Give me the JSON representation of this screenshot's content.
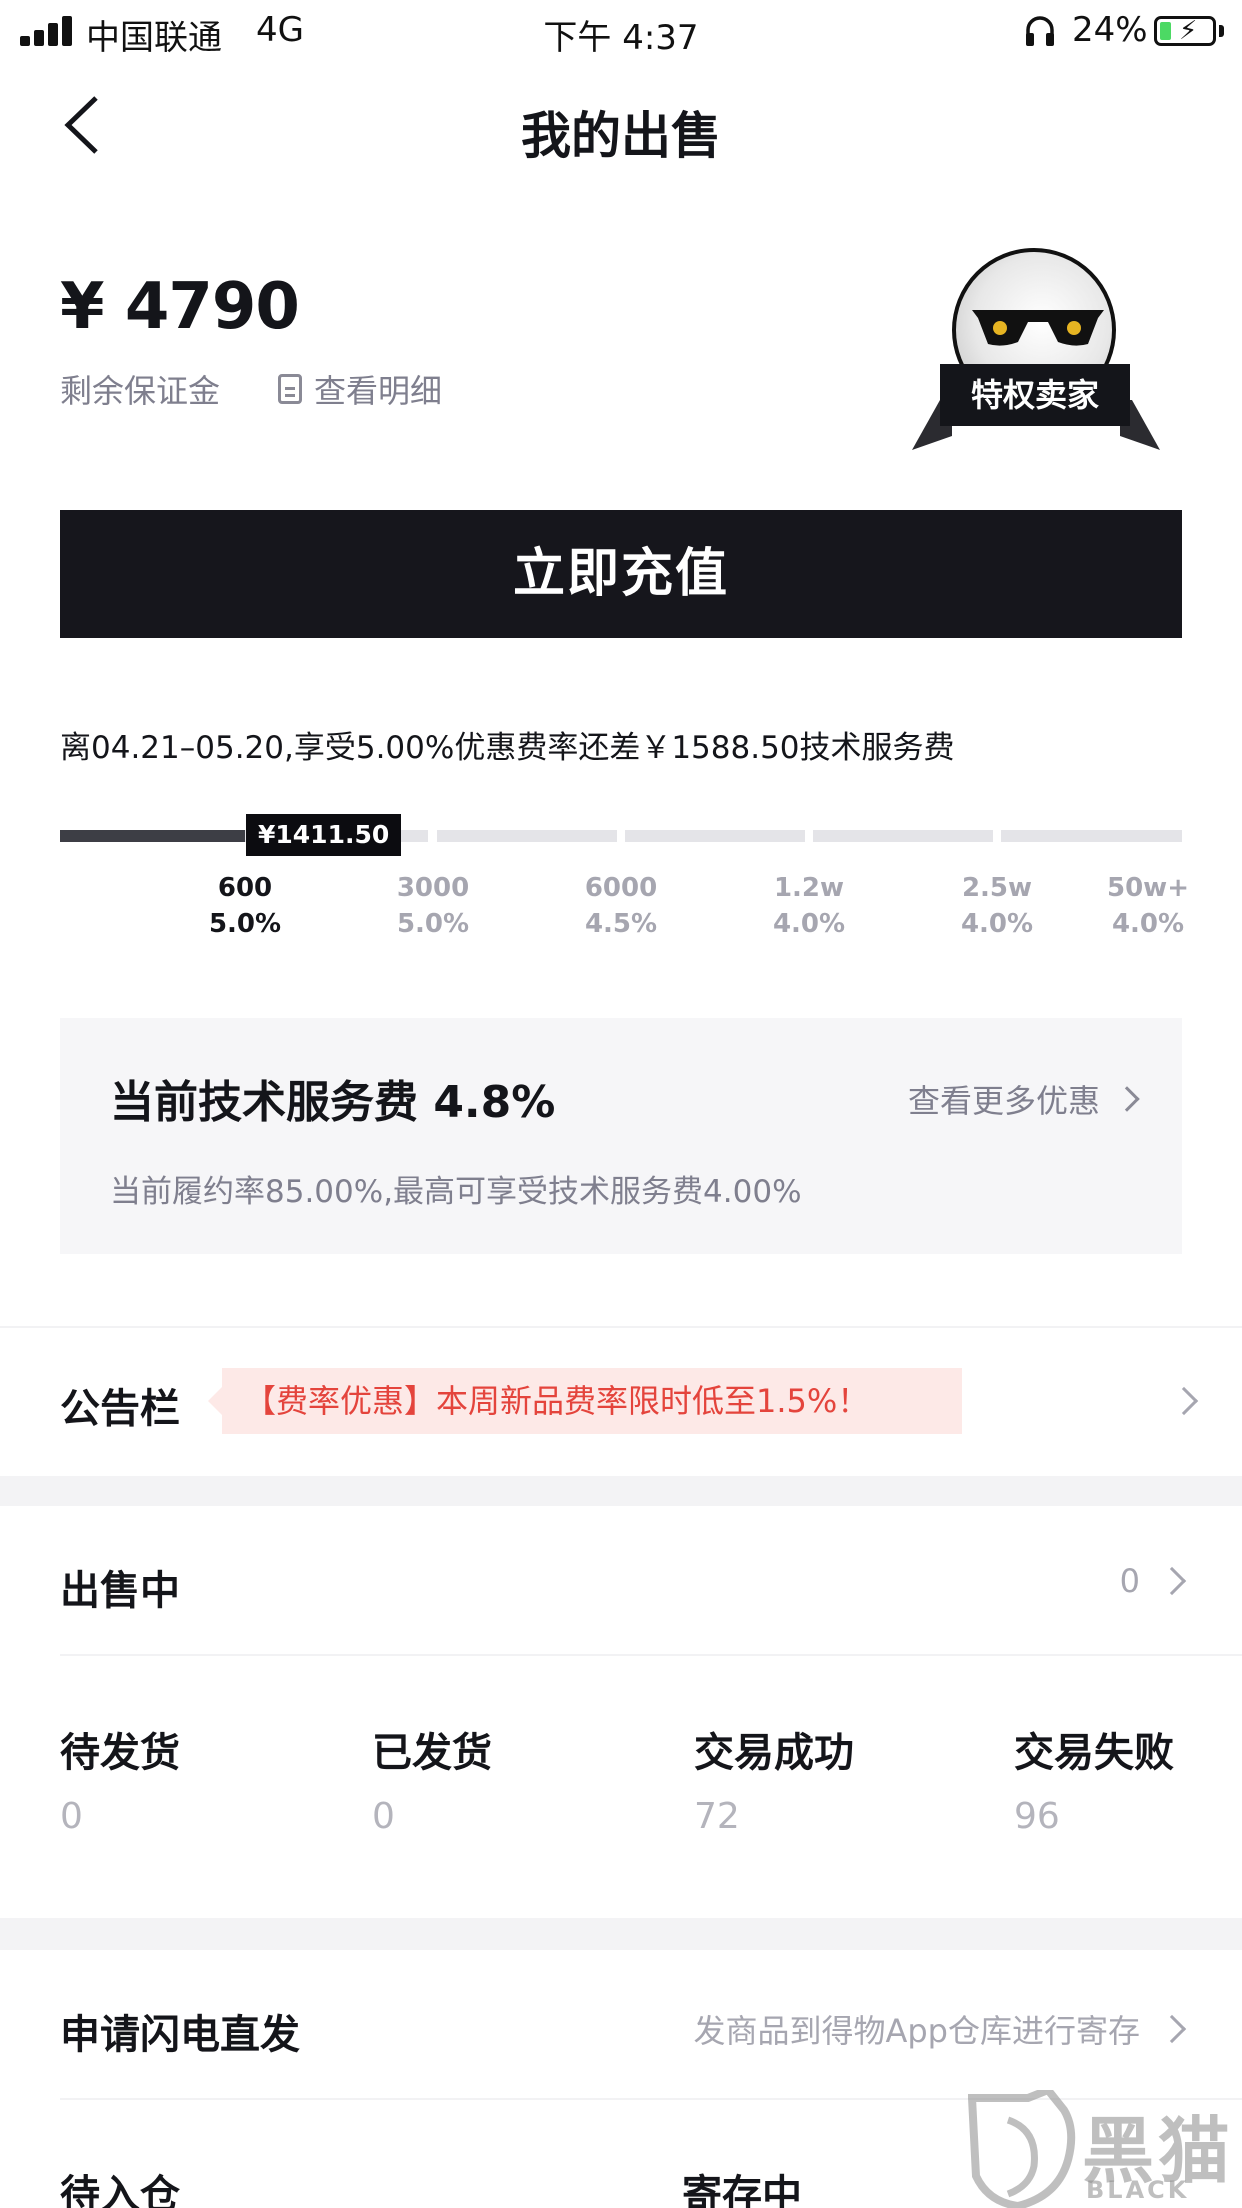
{
  "status_bar": {
    "carrier": "中国联通",
    "network": "4G",
    "time": "下午 4:37",
    "battery": "24%"
  },
  "header": {
    "title": "我的出售"
  },
  "deposit": {
    "amount": "¥ 4790",
    "label": "剩余保证金",
    "detail_link": "查看明细"
  },
  "seller_badge": "特权卖家",
  "recharge_label": "立即充值",
  "fee_notice": "离04.21–05.20,享受5.00%优惠费率还差￥1588.50技术服务费",
  "progress": {
    "current_value": "¥1411.50",
    "fraction": 0.165,
    "tiers": [
      {
        "threshold": "600",
        "rate": "5.0%"
      },
      {
        "threshold": "3000",
        "rate": "5.0%"
      },
      {
        "threshold": "6000",
        "rate": "4.5%"
      },
      {
        "threshold": "1.2w",
        "rate": "4.0%"
      },
      {
        "threshold": "2.5w",
        "rate": "4.0%"
      },
      {
        "threshold": "50w+",
        "rate": "4.0%"
      }
    ]
  },
  "current_fee": {
    "title": "当前技术服务费 4.8%",
    "more_link": "查看更多优惠",
    "subtitle": "当前履约率85.00%,最高可享受技术服务费4.00%"
  },
  "bulletin": {
    "label": "公告栏",
    "notice": "【费率优惠】本周新品费率限时低至1.5%！"
  },
  "on_sale": {
    "label": "出售中",
    "count": "0"
  },
  "order_stats": [
    {
      "label": "待发货",
      "value": "0"
    },
    {
      "label": "已发货",
      "value": "0"
    },
    {
      "label": "交易成功",
      "value": "72"
    },
    {
      "label": "交易失败",
      "value": "96"
    }
  ],
  "lightning": {
    "label": "申请闪电直发",
    "hint": "发商品到得物App仓库进行寄存"
  },
  "storage": {
    "pending_label": "待入仓",
    "stored_label": "寄存中"
  },
  "watermark": {
    "text": "黑猫",
    "sub": "BLACK CAT"
  },
  "colors": {
    "accent_dark": "#16161c",
    "notice_red": "#e4443c",
    "notice_bg": "#fde9e7"
  }
}
